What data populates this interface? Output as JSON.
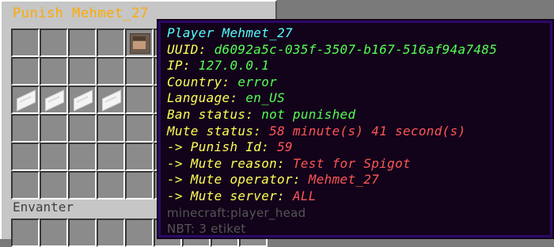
{
  "gui": {
    "title_a": "Punish",
    "title_b": "Mehmet_27",
    "inventory_label": "Envanter"
  },
  "icons": {
    "player_head": "player-head-icon",
    "paper": "paper-icon"
  },
  "tooltip": {
    "header_label": "Player",
    "header_name": "Mehmet_27",
    "uuid_label": "UUID:",
    "uuid_value": "d6092a5c-035f-3507-b167-516af94a7485",
    "ip_label": "IP:",
    "ip_value": "127.0.0.1",
    "country_label": "Country:",
    "country_value": "error",
    "language_label": "Language:",
    "language_value": "en_US",
    "ban_label": "Ban status:",
    "ban_value": "not punished",
    "mute_label": "Mute status:",
    "mute_value": "58 minute(s) 41 second(s)",
    "punish_id_label": "-> Punish Id:",
    "punish_id_value": "59",
    "reason_label": "-> Mute reason:",
    "reason_value": "Test for Spigot",
    "operator_label": "-> Mute operator:",
    "operator_value": "Mehmet_27",
    "server_label": "-> Mute server:",
    "server_value": "ALL",
    "item_id": "minecraft:player_head",
    "nbt": "NBT: 3 etiket"
  },
  "colors": {
    "yellow": "#ffff55",
    "green": "#55ff55",
    "red": "#ff5555",
    "aqua": "#55ffff",
    "gray": "#555555",
    "title": "#ffaa00"
  }
}
